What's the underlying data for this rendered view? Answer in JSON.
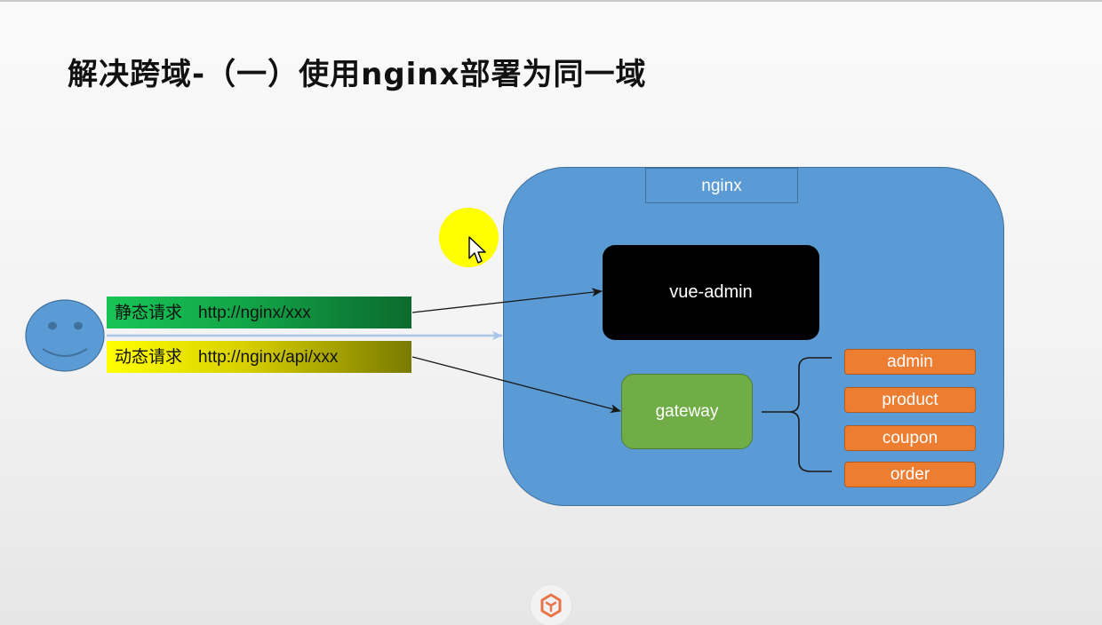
{
  "slide": {
    "title": "解决跨域-（一）使用nginx部署为同一域"
  },
  "diagram": {
    "nginx_label": "nginx",
    "vue_admin_label": "vue-admin",
    "gateway_label": "gateway",
    "services": [
      "admin",
      "product",
      "coupon",
      "order"
    ],
    "requests": {
      "static": {
        "label": "静态请求",
        "url": "http://nginx/xxx"
      },
      "dynamic": {
        "label": "动态请求",
        "url": "http://nginx/api/xxx"
      }
    }
  },
  "colors": {
    "nginx_fill": "#5b9bd5",
    "vue_admin_fill": "#000000",
    "gateway_fill": "#70ad47",
    "service_fill": "#ed7d31",
    "static_request_fill": "#12a548",
    "dynamic_request_fill": "#ffff00",
    "cursor_highlight": "#ffff00"
  },
  "icons": {
    "user": "smiley-face-icon",
    "pointer": "mouse-cursor-icon",
    "logo": "app-logo-icon"
  }
}
